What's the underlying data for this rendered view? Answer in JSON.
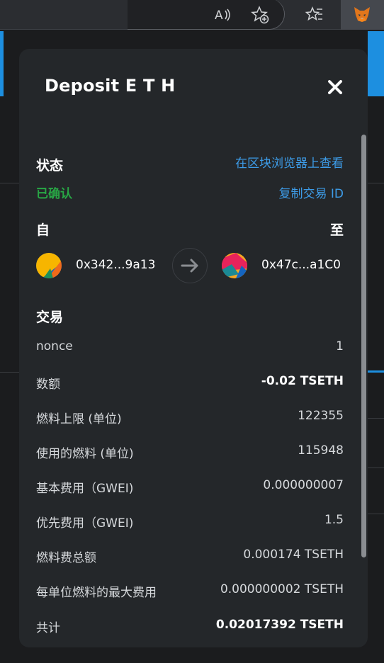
{
  "colors": {
    "accent_link": "#3d9ce8",
    "confirmed": "#28a745",
    "panel": "#24272a"
  },
  "browser": {
    "icons": [
      "read-aloud-icon",
      "add-favorite-icon",
      "favorites-icon",
      "metamask-fox-icon"
    ]
  },
  "modal": {
    "title": "Deposit E T H",
    "status_label": "状态",
    "view_on_explorer": "在区块浏览器上查看",
    "status_value": "已确认",
    "copy_tx_id": "复制交易 ID",
    "from_label": "自",
    "to_label": "至",
    "from_address": "0x342...9a13",
    "to_address": "0x47c...a1C0",
    "transaction_heading": "交易",
    "rows": [
      {
        "label": "nonce",
        "value": "1"
      },
      {
        "label": "数额",
        "value": "-0.02 TSETH"
      },
      {
        "label": "燃料上限 (单位)",
        "value": "122355"
      },
      {
        "label": "使用的燃料 (单位)",
        "value": "115948"
      },
      {
        "label": "基本费用（GWEI)",
        "value": "0.000000007"
      },
      {
        "label": "优先费用（GWEI)",
        "value": "1.5"
      },
      {
        "label": "燃料费总额",
        "value": "0.000174 TSETH"
      },
      {
        "label": "每单位燃料的最大费用",
        "value": "0.000000002 TSETH"
      },
      {
        "label": "共计",
        "value": "0.02017392 TSETH"
      }
    ]
  }
}
